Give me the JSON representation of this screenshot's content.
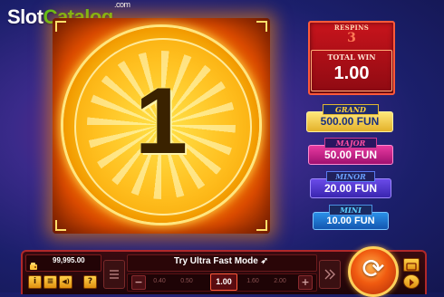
{
  "watermark": {
    "slot": "Slot",
    "catalog": "Catalog",
    "com": ".com"
  },
  "coin": {
    "number": "1"
  },
  "respins": {
    "label": "RESPINS",
    "count": "3"
  },
  "total_win": {
    "label": "TOTAL WIN",
    "value": "1.00"
  },
  "jackpots": {
    "grand": {
      "name": "GRAND",
      "value": "500.00 FUN"
    },
    "major": {
      "name": "MAJOR",
      "value": "50.00 FUN"
    },
    "minor": {
      "name": "MINOR",
      "value": "20.00 FUN"
    },
    "mini": {
      "name": "MINI",
      "value": "10.00 FUN"
    }
  },
  "bottom": {
    "balance": "99,995.00",
    "info_glyph": "i",
    "menu_glyph": "≡",
    "sound_glyph": "◀)",
    "help_glyph": "?",
    "mode_text": "Try Ultra Fast Mode ➶",
    "minus": "−",
    "plus": "+",
    "bet_chips": [
      "0.40",
      "0.50",
      "",
      "1.60",
      "2.00"
    ],
    "bet_current": "1.00",
    "spin_glyph": "⟳"
  },
  "colors": {
    "respins_panel": "#c8141c",
    "grand": "#e3b12a",
    "major": "#d0207f",
    "minor": "#4a34d0",
    "mini": "#1c6ed0"
  }
}
